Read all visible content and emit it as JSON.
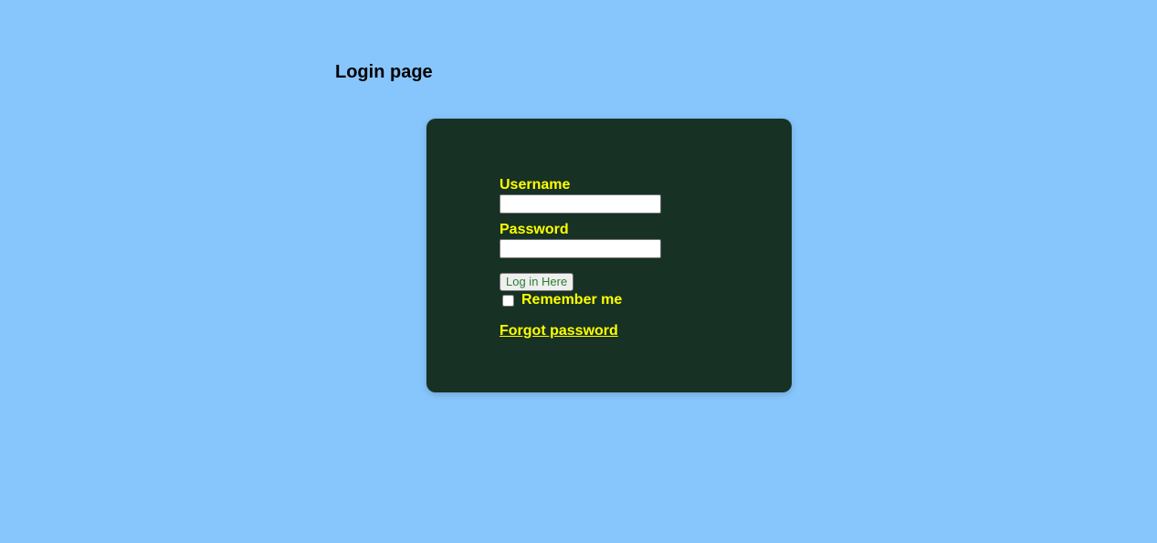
{
  "page": {
    "title": "Login page",
    "background_color": "#87c6fd"
  },
  "login_card": {
    "background_color": "#173124",
    "label_color": "#ffff00",
    "username": {
      "label": "Username",
      "value": "",
      "placeholder": ""
    },
    "password": {
      "label": "Password",
      "value": "",
      "placeholder": ""
    },
    "login_button_label": "Log in Here",
    "remember_me": {
      "label": "Remember me",
      "checked": false
    },
    "forgot_password_label": "Forgot password"
  }
}
